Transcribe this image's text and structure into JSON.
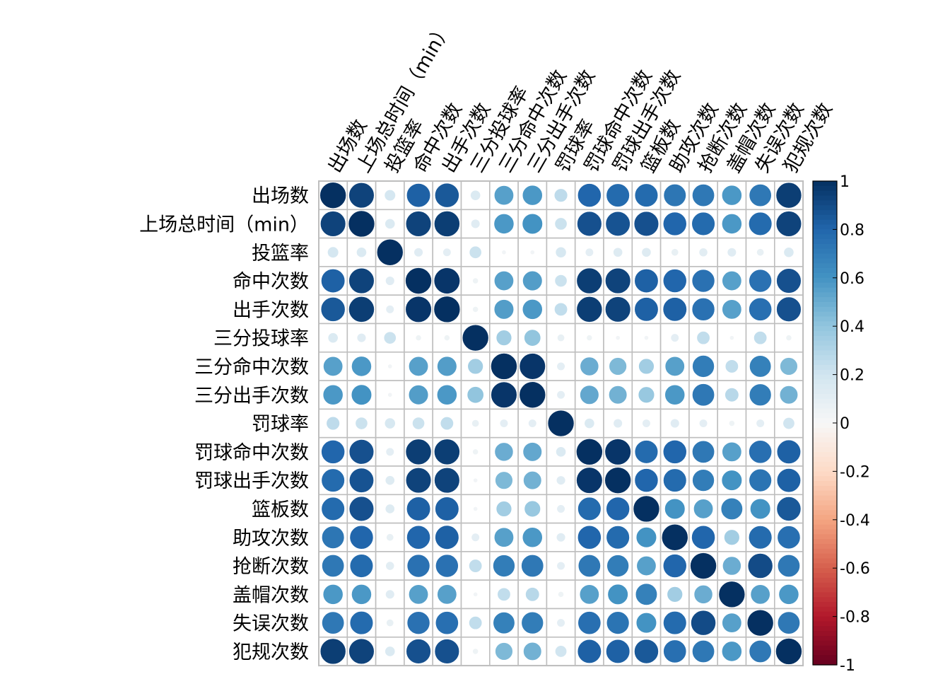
{
  "chart_data": {
    "type": "heatmap",
    "style": "corrplot-circle",
    "labels": [
      "出场数",
      "上场总时间（min）",
      "投篮率",
      "命中次数",
      "出手次数",
      "三分投球率",
      "三分命中次数",
      "三分出手次数",
      "罚球率",
      "罚球命中次数",
      "罚球出手次数",
      "篮板数",
      "助攻次数",
      "抢断次数",
      "盖帽次数",
      "失误次数",
      "犯规次数"
    ],
    "matrix": [
      [
        1.0,
        0.93,
        0.18,
        0.82,
        0.85,
        0.15,
        0.55,
        0.58,
        0.26,
        0.8,
        0.78,
        0.78,
        0.73,
        0.72,
        0.58,
        0.72,
        0.95
      ],
      [
        0.93,
        1.0,
        0.15,
        0.93,
        0.95,
        0.12,
        0.58,
        0.6,
        0.22,
        0.88,
        0.87,
        0.88,
        0.8,
        0.78,
        0.58,
        0.78,
        0.93
      ],
      [
        0.18,
        0.15,
        1.0,
        0.12,
        0.1,
        0.22,
        0.03,
        0.03,
        0.17,
        0.1,
        0.13,
        0.13,
        0.08,
        0.11,
        0.12,
        0.08,
        0.15
      ],
      [
        0.82,
        0.93,
        0.12,
        1.0,
        0.98,
        0.05,
        0.55,
        0.56,
        0.22,
        0.95,
        0.93,
        0.82,
        0.8,
        0.75,
        0.55,
        0.75,
        0.88
      ],
      [
        0.85,
        0.95,
        0.1,
        0.98,
        1.0,
        0.05,
        0.56,
        0.58,
        0.25,
        0.95,
        0.93,
        0.82,
        0.82,
        0.75,
        0.55,
        0.76,
        0.88
      ],
      [
        0.15,
        0.12,
        0.22,
        0.05,
        0.05,
        1.0,
        0.35,
        0.4,
        0.08,
        0.05,
        0.03,
        0.03,
        0.1,
        0.25,
        0.03,
        0.25,
        0.05
      ],
      [
        0.55,
        0.58,
        0.03,
        0.55,
        0.56,
        0.35,
        1.0,
        0.98,
        0.1,
        0.5,
        0.45,
        0.35,
        0.55,
        0.7,
        0.25,
        0.68,
        0.45
      ],
      [
        0.58,
        0.6,
        0.03,
        0.56,
        0.58,
        0.4,
        0.98,
        1.0,
        0.1,
        0.52,
        0.48,
        0.38,
        0.58,
        0.72,
        0.28,
        0.7,
        0.48
      ],
      [
        0.26,
        0.22,
        0.17,
        0.22,
        0.25,
        0.08,
        0.1,
        0.1,
        1.0,
        0.15,
        0.12,
        0.1,
        0.12,
        0.1,
        0.05,
        0.1,
        0.2
      ],
      [
        0.8,
        0.88,
        0.1,
        0.95,
        0.95,
        0.05,
        0.5,
        0.52,
        0.15,
        1.0,
        0.98,
        0.78,
        0.8,
        0.72,
        0.55,
        0.76,
        0.82
      ],
      [
        0.78,
        0.87,
        0.13,
        0.93,
        0.93,
        0.03,
        0.45,
        0.48,
        0.12,
        0.98,
        1.0,
        0.8,
        0.78,
        0.7,
        0.6,
        0.74,
        0.82
      ],
      [
        0.78,
        0.88,
        0.13,
        0.82,
        0.82,
        0.03,
        0.35,
        0.38,
        0.1,
        0.78,
        0.8,
        1.0,
        0.6,
        0.55,
        0.68,
        0.6,
        0.85
      ],
      [
        0.73,
        0.8,
        0.08,
        0.8,
        0.82,
        0.1,
        0.55,
        0.58,
        0.12,
        0.8,
        0.78,
        0.6,
        1.0,
        0.8,
        0.35,
        0.78,
        0.76
      ],
      [
        0.72,
        0.78,
        0.11,
        0.75,
        0.75,
        0.25,
        0.7,
        0.72,
        0.1,
        0.72,
        0.7,
        0.55,
        0.8,
        1.0,
        0.5,
        0.9,
        0.72
      ],
      [
        0.58,
        0.58,
        0.12,
        0.55,
        0.55,
        0.03,
        0.25,
        0.28,
        0.05,
        0.55,
        0.6,
        0.68,
        0.35,
        0.5,
        1.0,
        0.55,
        0.58
      ],
      [
        0.72,
        0.78,
        0.08,
        0.75,
        0.76,
        0.25,
        0.68,
        0.7,
        0.1,
        0.76,
        0.74,
        0.6,
        0.78,
        0.9,
        0.55,
        1.0,
        0.72
      ],
      [
        0.95,
        0.93,
        0.15,
        0.88,
        0.88,
        0.05,
        0.45,
        0.48,
        0.2,
        0.82,
        0.82,
        0.85,
        0.76,
        0.72,
        0.58,
        0.72,
        1.0
      ]
    ],
    "colorbar": {
      "ticks": [
        "1",
        "0.8",
        "0.6",
        "0.4",
        "0.2",
        "0",
        "-0.2",
        "-0.4",
        "-0.6",
        "-0.8",
        "-1"
      ],
      "range": [
        -1,
        1
      ],
      "palette": "RdBu"
    }
  }
}
